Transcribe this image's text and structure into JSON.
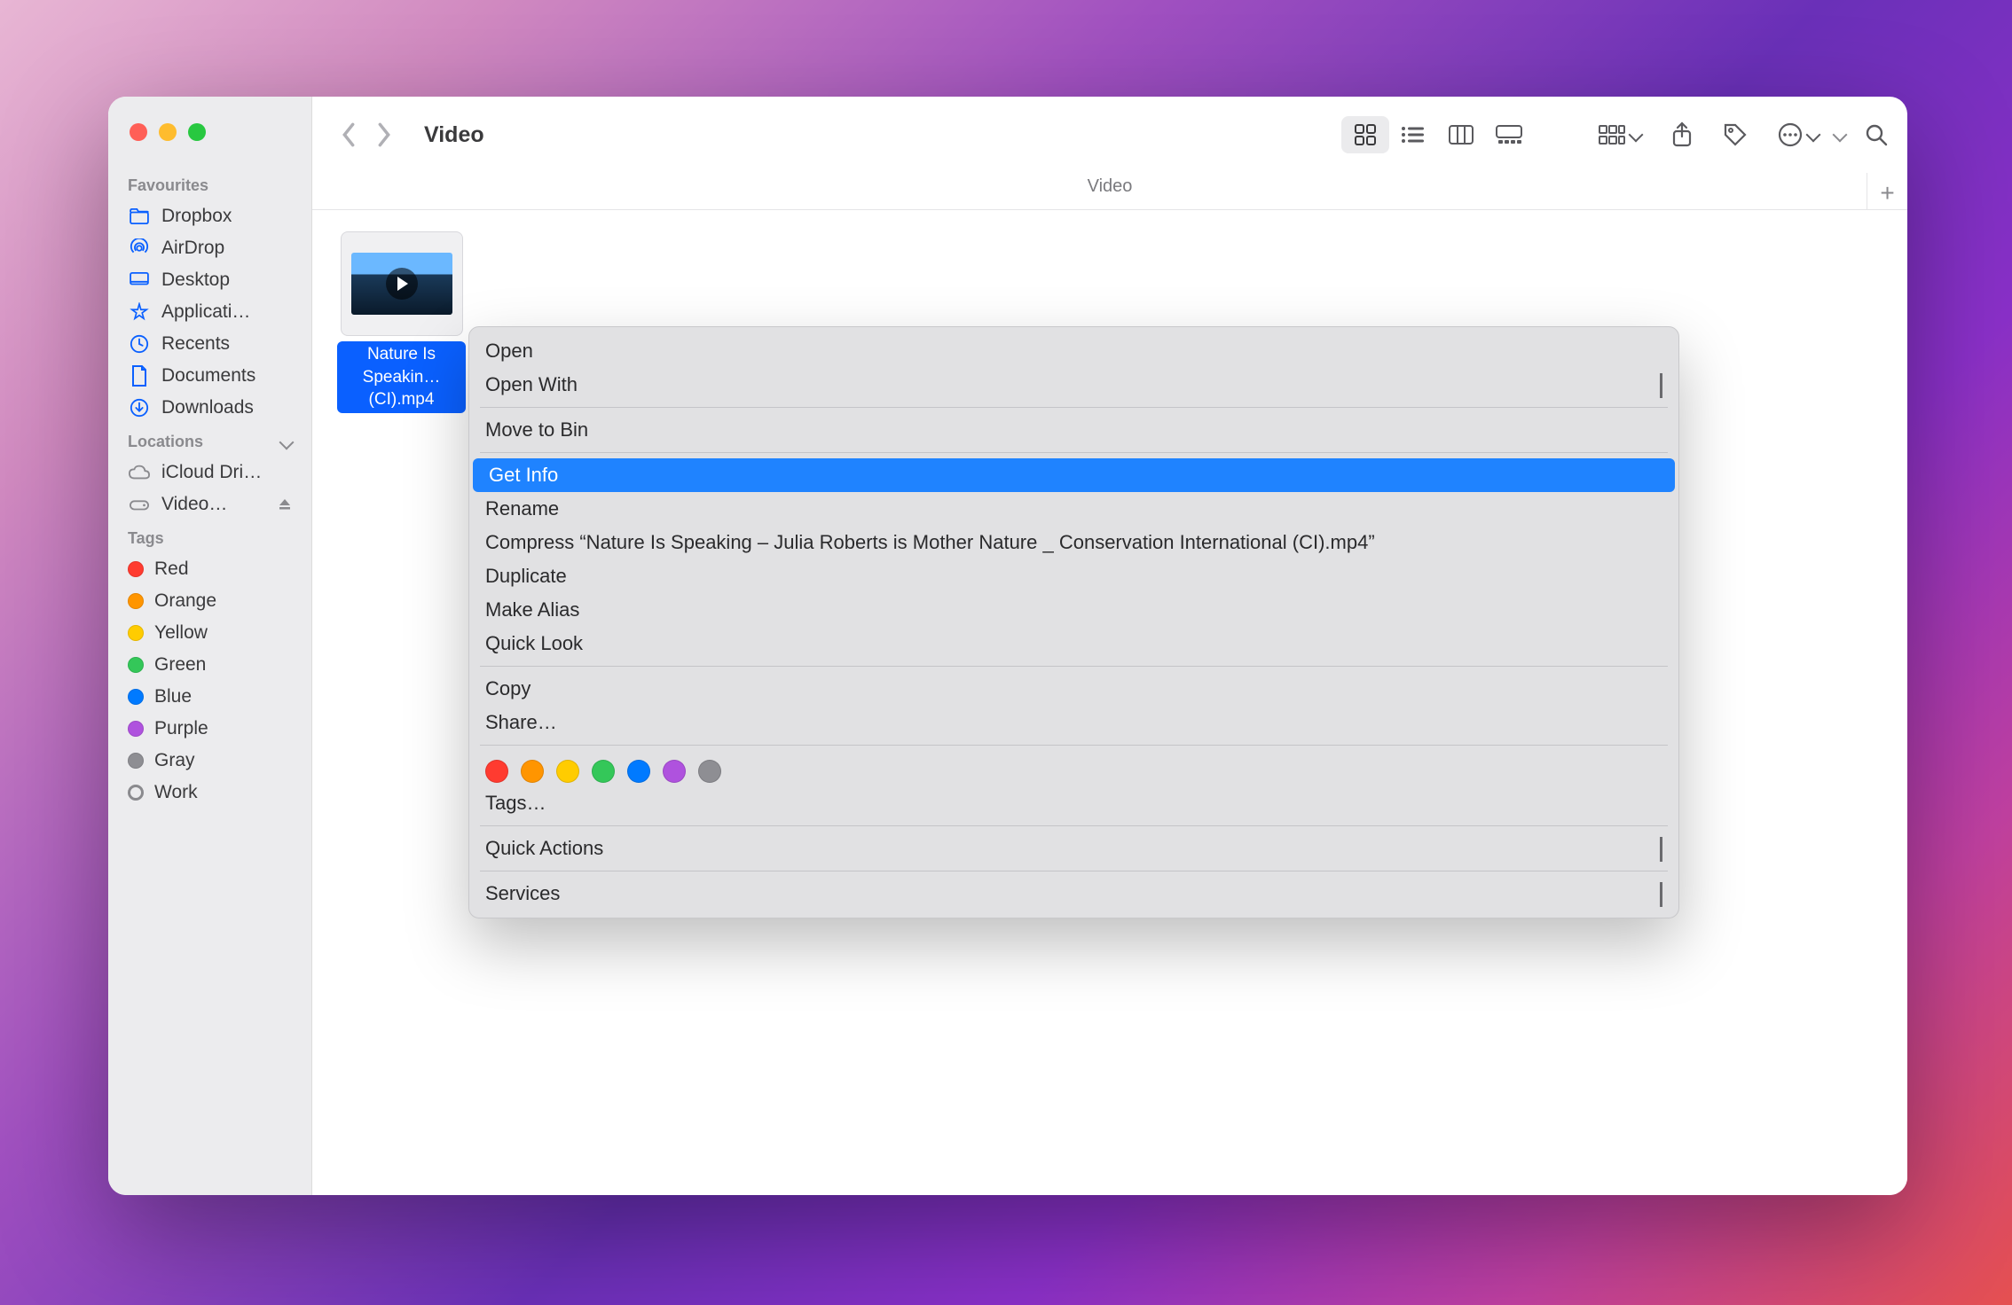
{
  "window": {
    "title": "Video",
    "path_label": "Video"
  },
  "sidebar": {
    "sections": {
      "favourites_title": "Favourites",
      "locations_title": "Locations",
      "tags_title": "Tags"
    },
    "favourites": [
      {
        "label": "Dropbox"
      },
      {
        "label": "AirDrop"
      },
      {
        "label": "Desktop"
      },
      {
        "label": "Applicati…"
      },
      {
        "label": "Recents"
      },
      {
        "label": "Documents"
      },
      {
        "label": "Downloads"
      }
    ],
    "locations": [
      {
        "label": "iCloud Dri…"
      },
      {
        "label": "Video…"
      }
    ],
    "tags": [
      {
        "label": "Red",
        "color": "#ff3b30"
      },
      {
        "label": "Orange",
        "color": "#ff9500"
      },
      {
        "label": "Yellow",
        "color": "#ffcc00"
      },
      {
        "label": "Green",
        "color": "#34c759"
      },
      {
        "label": "Blue",
        "color": "#007aff"
      },
      {
        "label": "Purple",
        "color": "#af52de"
      },
      {
        "label": "Gray",
        "color": "#8e8e93"
      },
      {
        "label": "Work",
        "color": ""
      }
    ]
  },
  "file": {
    "name_line1": "Nature Is",
    "name_line2": "Speakin…(CI).mp4"
  },
  "context_menu": {
    "open": "Open",
    "open_with": "Open With",
    "move_to_bin": "Move to Bin",
    "get_info": "Get Info",
    "rename": "Rename",
    "compress": "Compress “Nature Is Speaking – Julia Roberts is Mother Nature _ Conservation International (CI).mp4”",
    "duplicate": "Duplicate",
    "make_alias": "Make Alias",
    "quick_look": "Quick Look",
    "copy": "Copy",
    "share": "Share…",
    "tags_label": "Tags…",
    "quick_actions": "Quick Actions",
    "services": "Services",
    "tag_colors": [
      "#ff3b30",
      "#ff9500",
      "#ffcc00",
      "#34c759",
      "#007aff",
      "#af52de",
      "#8e8e93"
    ]
  }
}
